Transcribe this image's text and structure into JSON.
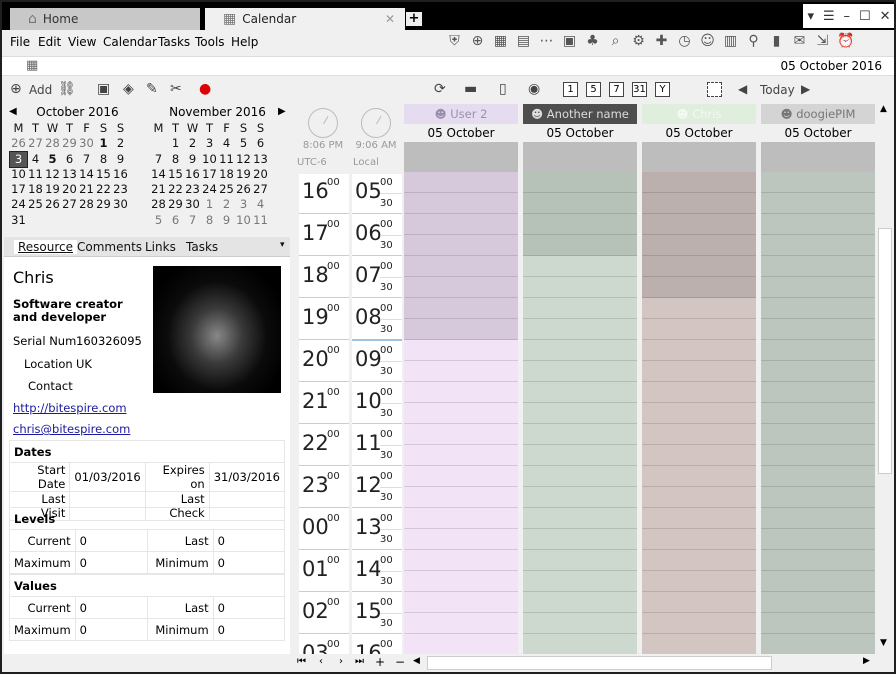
{
  "tabs": [
    {
      "label": "Home",
      "icon": "home-icon"
    },
    {
      "label": "Calendar",
      "icon": "calendar-icon"
    }
  ],
  "menu": [
    "File",
    "Edit",
    "View",
    "Calendar",
    "Tasks",
    "Tools",
    "Help"
  ],
  "address": {
    "date": "05 October 2016"
  },
  "toolbar": {
    "add_label": "Add",
    "today_label": "Today"
  },
  "october": {
    "title": "October 2016",
    "days": [
      "M",
      "T",
      "W",
      "T",
      "F",
      "S",
      "S"
    ],
    "cells": [
      "26",
      "27",
      "28",
      "29",
      "30",
      "1",
      "2",
      "3",
      "4",
      "5",
      "6",
      "7",
      "8",
      "9",
      "10",
      "11",
      "12",
      "13",
      "14",
      "15",
      "16",
      "17",
      "18",
      "19",
      "20",
      "21",
      "22",
      "23",
      "24",
      "25",
      "26",
      "27",
      "28",
      "29",
      "30",
      "31"
    ]
  },
  "november": {
    "title": "November 2016",
    "days": [
      "M",
      "T",
      "W",
      "T",
      "F",
      "S",
      "S"
    ],
    "cells": [
      "",
      "1",
      "2",
      "3",
      "4",
      "5",
      "6",
      "7",
      "8",
      "9",
      "10",
      "11",
      "12",
      "13",
      "14",
      "15",
      "16",
      "17",
      "18",
      "19",
      "20",
      "21",
      "22",
      "23",
      "24",
      "25",
      "26",
      "27",
      "28",
      "29",
      "30",
      "1",
      "2",
      "3",
      "4",
      "5",
      "6",
      "7",
      "8",
      "9",
      "10",
      "11"
    ]
  },
  "detail_tabs": [
    "Resource",
    "Comments",
    "Links",
    "Tasks"
  ],
  "resource": {
    "name": "Chris",
    "title": "Software creator and developer",
    "serial_label": "Serial Num",
    "serial": "160326095",
    "location_label": "Location",
    "location": "UK",
    "contact_label": "Contact",
    "url": "http://bitespire.com",
    "email": "chris@bitespire.com"
  },
  "dates": {
    "heading": "Dates",
    "start_label": "Start Date",
    "start": "01/03/2016",
    "expires_label": "Expires on",
    "expires": "31/03/2016",
    "last_visit_label": "Last Visit",
    "last_check_label": "Last Check"
  },
  "levels": {
    "heading": "Levels",
    "current_label": "Current",
    "current": "0",
    "last_label": "Last",
    "last": "0",
    "max_label": "Maximum",
    "max": "0",
    "min_label": "Minimum",
    "min": "0"
  },
  "values": {
    "heading": "Values",
    "current_label": "Current",
    "current": "0",
    "last_label": "Last",
    "last": "0",
    "max_label": "Maximum",
    "max": "0",
    "min_label": "Minimum",
    "min": "0"
  },
  "timezones": [
    {
      "time": "8:06 PM",
      "label": "UTC-6"
    },
    {
      "time": "9:06 AM",
      "label": "Local"
    }
  ],
  "hours_a": [
    "16",
    "17",
    "18",
    "19",
    "20",
    "21",
    "22",
    "23",
    "00",
    "01",
    "02",
    "03"
  ],
  "hours_b": [
    "05",
    "06",
    "07",
    "08",
    "09",
    "10",
    "11",
    "12",
    "13",
    "14",
    "15",
    "16"
  ],
  "minutes": {
    "top": "00",
    "half": "30"
  },
  "resources": [
    {
      "name": "User 2",
      "date": "05 October",
      "header_bg": "#e6dcef",
      "header_color": "#9a8fae",
      "busy": "#d6c9dc",
      "free": "#f2e4f6"
    },
    {
      "name": "Another name",
      "date": "05 October",
      "header_bg": "#4e4e4e",
      "header_color": "#dddddd",
      "busy": "#b6c2b8",
      "free": "#cdd8cf"
    },
    {
      "name": "Chris",
      "date": "05 October",
      "header_bg": "#dfeedd",
      "header_color": "#f4f9f3",
      "busy": "#bcb0ae",
      "free": "#d3c5c2"
    },
    {
      "name": "doogiePIM",
      "date": "05 October",
      "header_bg": "#d4d4d4",
      "header_color": "#777777",
      "busy": "#bcc6bf",
      "free": "#bcc6bf"
    }
  ]
}
